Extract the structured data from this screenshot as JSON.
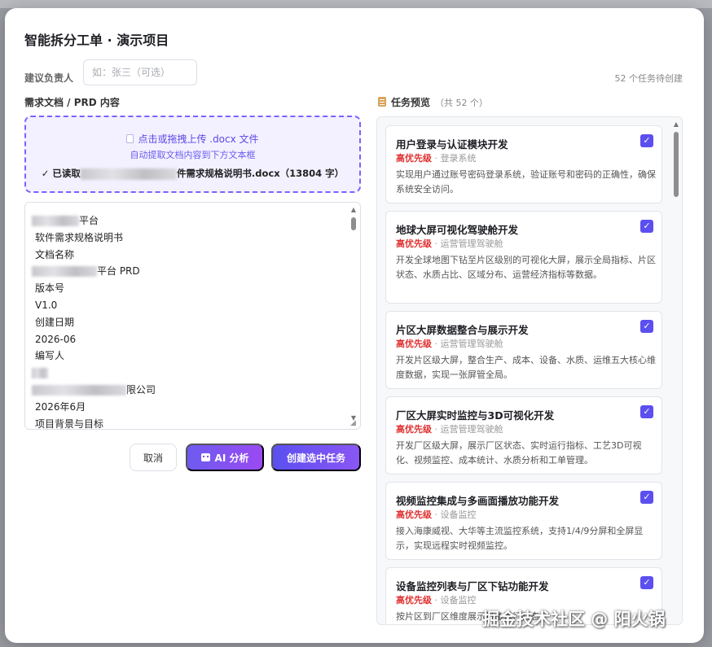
{
  "modal": {
    "title": "智能拆分工单 · 演示项目",
    "assignee_label": "建议负责人",
    "assignee_placeholder": "如：张三（可选）",
    "pending_count": "52 个任务待创建"
  },
  "left": {
    "section_label": "需求文档 / PRD 内容",
    "upload": {
      "line1": "点击或拖拽上传 .docx 文件",
      "line2": "自动提取文档内容到下方文本框",
      "read_prefix": "✓ 已读取",
      "read_suffix": "件需求规格说明书.docx（13804 字）"
    },
    "doc_lines": [
      "平台",
      "软件需求规格说明书",
      "文档名称",
      "平台 PRD",
      "版本号",
      "V1.0",
      "创建日期",
      "2026-06",
      "编写人",
      "",
      "限公司",
      "2026年6月",
      "项目背景与目标"
    ],
    "buttons": {
      "cancel": "取消",
      "ai": "AI 分析",
      "create": "创建选中任务"
    }
  },
  "right": {
    "header": "任务预览",
    "total": "（共 52 个）",
    "tasks": [
      {
        "title": "用户登录与认证模块开发",
        "priority": "高优先级",
        "module": "· 登录系统",
        "desc": "实现用户通过账号密码登录系统，验证账号和密码的正确性，确保系统安全访问。",
        "checked": true
      },
      {
        "title": "地球大屏可视化驾驶舱开发",
        "priority": "高优先级",
        "module": "· 运营管理驾驶舱",
        "desc": "开发全球地图下钻至片区级别的可视化大屏，展示全局指标、片区状态、水质占比、区域分布、运营经济指标等数据。",
        "checked": true
      },
      {
        "title": "片区大屏数据整合与展示开发",
        "priority": "高优先级",
        "module": "· 运营管理驾驶舱",
        "desc": "开发片区级大屏，整合生产、成本、设备、水质、运维五大核心维度数据，实现一张屏管全局。",
        "checked": true
      },
      {
        "title": "厂区大屏实时监控与3D可视化开发",
        "priority": "高优先级",
        "module": "· 运营管理驾驶舱",
        "desc": "开发厂区级大屏，展示厂区状态、实时运行指标、工艺3D可视化、视频监控、成本统计、水质分析和工单管理。",
        "checked": true
      },
      {
        "title": "视频监控集成与多画面播放功能开发",
        "priority": "高优先级",
        "module": "· 设备监控",
        "desc": "接入海康威视、大华等主流监控系统，支持1/4/9分屏和全屏显示，实现远程实时视频监控。",
        "checked": true
      },
      {
        "title": "设备监控列表与厂区下钻功能开发",
        "priority": "高优先级",
        "module": "· 设备监控",
        "desc": "按片区到厂区维度展示设备运行状态",
        "checked": true
      }
    ]
  },
  "watermark": "掘金技术社区 @ 阳火锅",
  "colors": {
    "accent": "#5b4ff0",
    "priority": "#e03131",
    "upload_border": "#7b61ff"
  }
}
